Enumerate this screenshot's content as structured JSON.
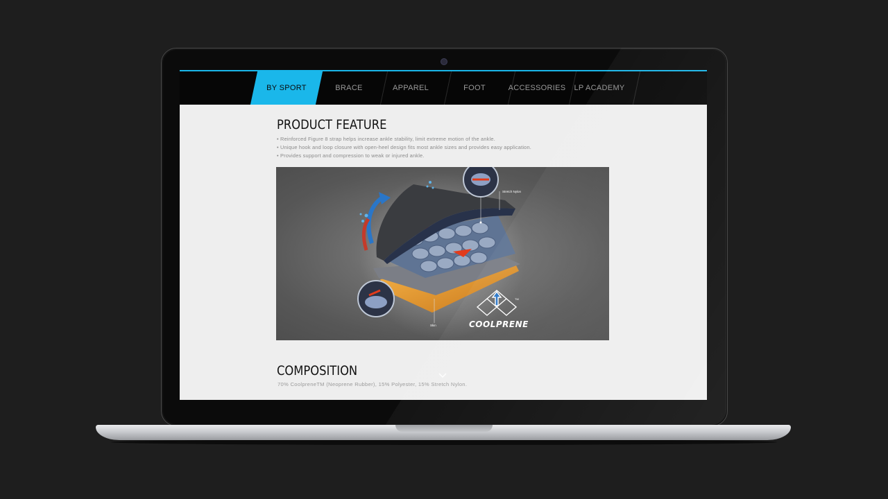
{
  "nav": {
    "items": [
      {
        "label": "BY SPORT",
        "active": true
      },
      {
        "label": "BRACE",
        "active": false
      },
      {
        "label": "APPAREL",
        "active": false
      },
      {
        "label": "FOOT",
        "active": false
      },
      {
        "label": "ACCESSORIES",
        "active": false
      },
      {
        "label": "LP ACADEMY",
        "active": false
      }
    ],
    "accent_color": "#1ab7ea"
  },
  "product_feature": {
    "title": "PRODUCT FEATURE",
    "bullets": [
      "• Reinforced Figure 8 strap helps increase ankle stability, limit extreme motion of the ankle.",
      "• Unique hook and loop closure with open-heel design fits most ankle sizes and provides easy application.",
      "• Provides support and compression to weak or injured ankle."
    ]
  },
  "figure": {
    "label_stretch": "Stretch Nylon",
    "label_skin": "Skin",
    "logo_text": "COOLPRENE",
    "logo_tm": "TM"
  },
  "composition": {
    "title": "COMPOSITION",
    "text": "70% CoolpreneTM (Neoprene Rubber), 15% Polyester, 15% Stretch Nylon."
  },
  "icons": [
    "chevron-down-icon",
    "camera"
  ]
}
